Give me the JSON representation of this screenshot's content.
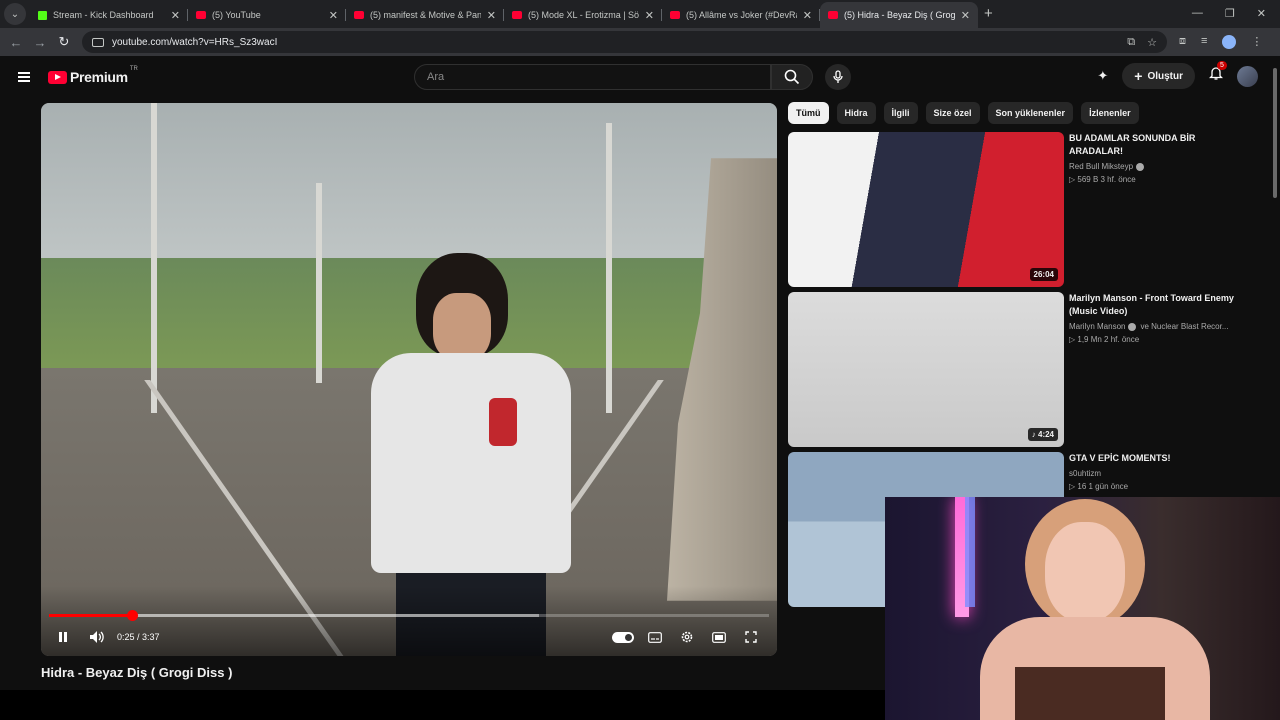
{
  "browser": {
    "tabs": [
      {
        "title": "Stream - Kick Dashboard",
        "fav": "kick"
      },
      {
        "title": "(5) YouTube",
        "fav": "yt"
      },
      {
        "title": "(5) manifest & Motive & Pango",
        "fav": "yt"
      },
      {
        "title": "(5) Mode XL - Erotizma | Sözler",
        "fav": "yt"
      },
      {
        "title": "(5) Allâme vs Joker (#DevRap Fi",
        "fav": "yt"
      },
      {
        "title": "(5) Hidra - Beyaz Diş ( Grog",
        "fav": "yt",
        "active": true
      }
    ],
    "url": "youtube.com/watch?v=HRs_Sz3wacI"
  },
  "masthead": {
    "logo_text": "Premium",
    "region": "TR",
    "search_placeholder": "Ara",
    "create_label": "Oluştur",
    "notif_count": "5"
  },
  "player": {
    "time": "0:25 / 3:37",
    "progress": 0.115,
    "buffered": 0.68,
    "title": "Hidra - Beyaz Diş ( Grogi Diss )"
  },
  "chips": [
    "Tümü",
    "Hidra",
    "İlgili",
    "Size özel",
    "Son yüklenenler",
    "İzlenenler"
  ],
  "recommendations": [
    {
      "title": "BU ADAMLAR SONUNDA BİR ARADALAR!",
      "channel": "Red Bull Miksteyp",
      "verified": true,
      "meta": "▷ 569 B   3 hf. önce",
      "duration": "26:04",
      "thumb": "t1"
    },
    {
      "title": "Marilyn Manson - Front Toward Enemy (Music Video)",
      "channel": "Marilyn Manson",
      "channel_extra": "ve Nuclear Blast Recor...",
      "verified": true,
      "meta": "▷ 1,9 Mn   2 hf. önce",
      "duration": "♪ 4:24",
      "thumb": "t2"
    },
    {
      "title": "GTA V EPİC MOMENTS!",
      "channel": "s0uhtizm",
      "verified": false,
      "meta": "▷ 16   1 gün önce",
      "duration": "",
      "thumb": "t3"
    }
  ]
}
